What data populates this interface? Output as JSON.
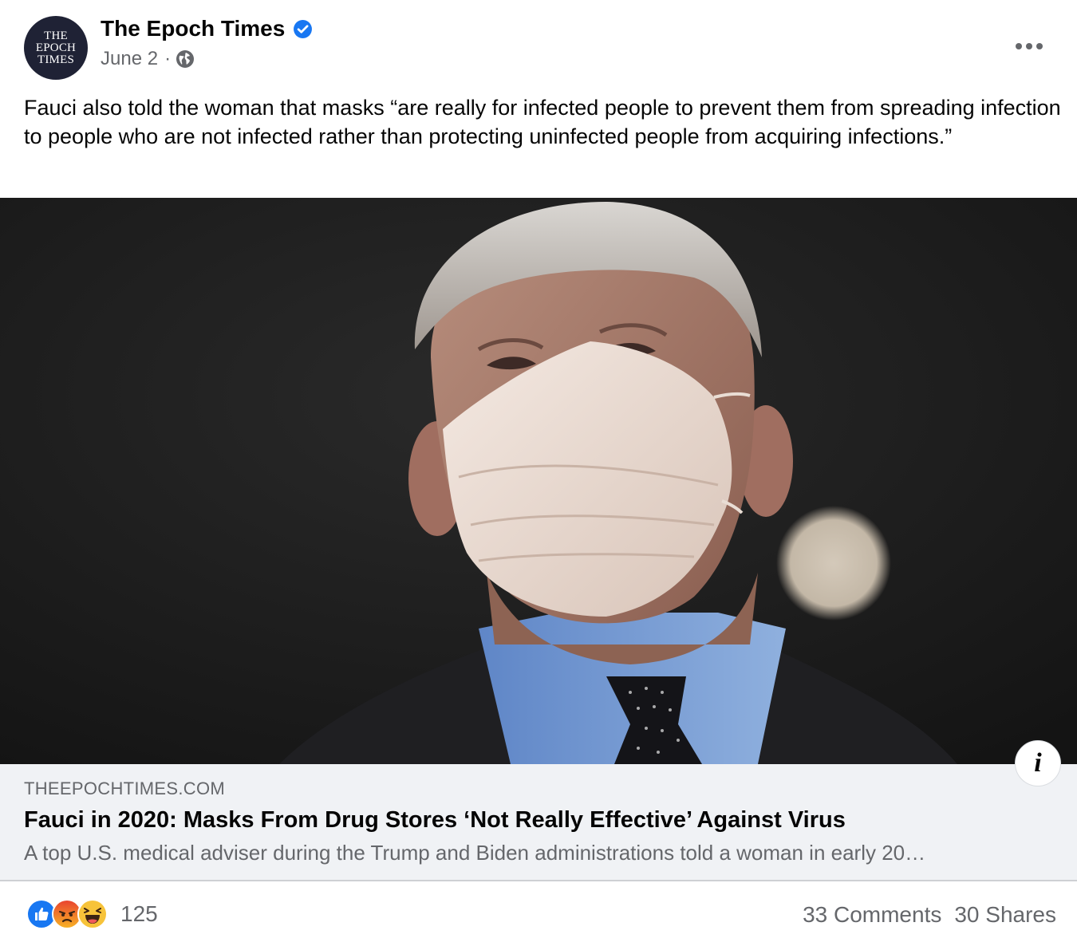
{
  "page": {
    "avatar_lines": [
      "THE",
      "EPOCH",
      "TIMES"
    ],
    "name": "The Epoch Times",
    "date": "June 2",
    "separator": "·"
  },
  "icons": {
    "verified": "verified-badge-icon",
    "privacy": "globe-icon",
    "more": "more-options-icon",
    "info": "info-icon"
  },
  "post": {
    "caption": "Fauci also told the woman that masks “are really for infected people to prevent them from spreading infection to people who are not infected rather than protecting uninfected people from acquiring infections.”"
  },
  "link_preview": {
    "domain": "THEEPOCHTIMES.COM",
    "headline": "Fauci in 2020: Masks From Drug Stores ‘Not Really Effective’ Against Virus",
    "description": "A top U.S. medical adviser during the Trump and Biden administrations told a woman in early 20…",
    "info_label": "i"
  },
  "engagement": {
    "reactions": [
      "like",
      "angry",
      "haha"
    ],
    "reaction_count": "125",
    "comments": "33 Comments",
    "shares": "30 Shares"
  },
  "colors": {
    "accent": "#1877f2",
    "secondary_text": "#65676b",
    "preview_bg": "#f0f2f5"
  }
}
